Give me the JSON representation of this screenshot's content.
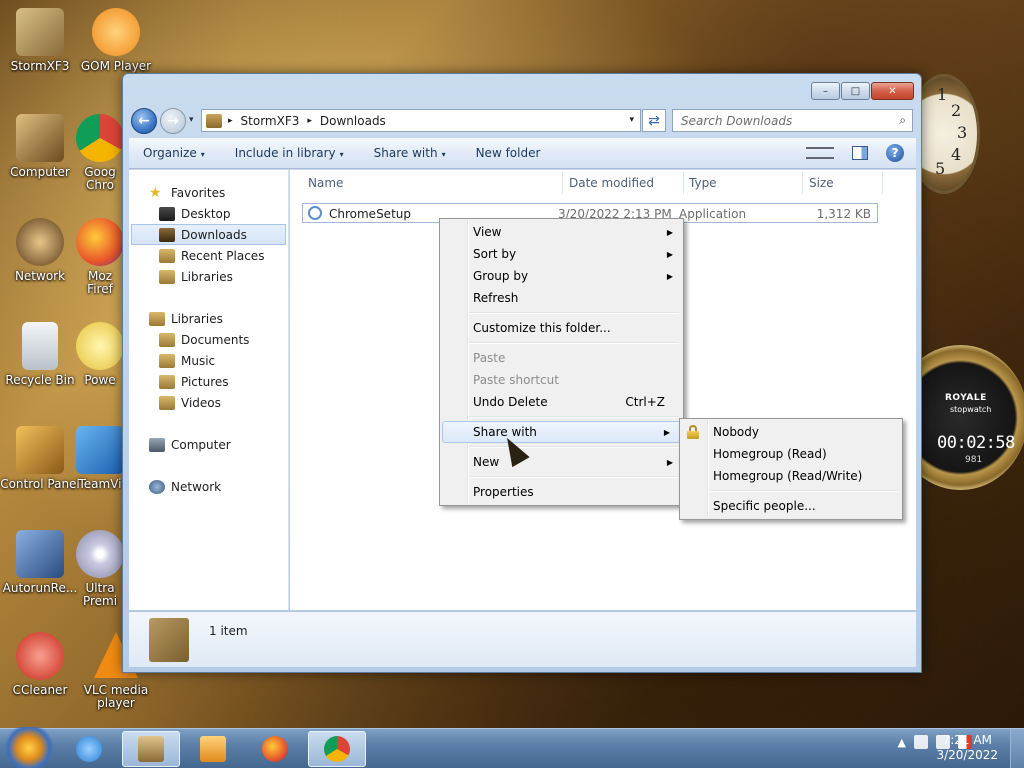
{
  "desktop": {
    "icons": [
      {
        "label": "StormXF3",
        "color": "#a88a52"
      },
      {
        "label": "GOM Player",
        "color": "#f39a1c"
      },
      {
        "label": "Computer",
        "color": "#c9a060"
      },
      {
        "label": "Goog Chro",
        "color": "#3d9b4a"
      },
      {
        "label": "Network",
        "color": "#c39a5a"
      },
      {
        "label": "Moz Firef",
        "color": "#e8752a"
      },
      {
        "label": "Recycle Bin",
        "color": "#d8dde2"
      },
      {
        "label": "Powe",
        "color": "#e6c23a"
      },
      {
        "label": "Control Panel",
        "color": "#c98a2e"
      },
      {
        "label": "TeamVi",
        "color": "#2c7fd1"
      },
      {
        "label": "AutorunRe...",
        "color": "#3a6ab8"
      },
      {
        "label": "Ultra Premi",
        "color": "#b0b0c0"
      },
      {
        "label": "CCleaner",
        "color": "#d33a2a"
      },
      {
        "label": "VLC media player",
        "color": "#f08a12"
      }
    ],
    "clock_numbers": [
      "1",
      "2",
      "3",
      "4",
      "5"
    ],
    "stopwatch": {
      "brand": "ROYALE",
      "sub": "stopwatch",
      "time": "00:02:58",
      "small": "981"
    }
  },
  "window": {
    "controls": {
      "minimize": "–",
      "maximize": "□",
      "close": "✕"
    },
    "nav": {
      "back": "←",
      "forward": "→",
      "history": "▾"
    },
    "address": {
      "crumbs": [
        "StormXF3",
        "Downloads"
      ],
      "sep": "▸",
      "drop": "▾"
    },
    "refresh": "⇄",
    "search": {
      "placeholder": "Search Downloads",
      "icon": "⌕"
    },
    "toolbar": {
      "organize": "Organize",
      "include": "Include in library",
      "share": "Share with",
      "new_folder": "New folder",
      "caret": "▾",
      "help": "?"
    },
    "nav_pane": {
      "favorites": "Favorites",
      "desktop": "Desktop",
      "downloads": "Downloads",
      "recent": "Recent Places",
      "libraries_fav": "Libraries",
      "libraries": "Libraries",
      "documents": "Documents",
      "music": "Music",
      "pictures": "Pictures",
      "videos": "Videos",
      "computer": "Computer",
      "network": "Network",
      "star": "★"
    },
    "columns": {
      "name": "Name",
      "date": "Date modified",
      "type": "Type",
      "size": "Size"
    },
    "file": {
      "name": "ChromeSetup",
      "date": "3/20/2022 2:13 PM",
      "type": "Application",
      "size": "1,312 KB"
    },
    "details": {
      "count": "1 item"
    }
  },
  "context_menu": {
    "view": "View",
    "sort_by": "Sort by",
    "group_by": "Group by",
    "refresh": "Refresh",
    "customize": "Customize this folder...",
    "paste": "Paste",
    "paste_shortcut": "Paste shortcut",
    "undo_delete": "Undo Delete",
    "undo_shortcut": "Ctrl+Z",
    "share_with": "Share with",
    "new": "New",
    "properties": "Properties",
    "arrow": "▶"
  },
  "share_submenu": {
    "nobody": "Nobody",
    "hg_read": "Homegroup (Read)",
    "hg_readwrite": "Homegroup (Read/Write)",
    "specific": "Specific people..."
  },
  "taskbar": {
    "time": "7:21 AM",
    "date": "3/20/2022",
    "tray_arrow": "▲",
    "buttons": [
      {
        "name": "ie-taskbar-button",
        "color": "#2a7fd6"
      },
      {
        "name": "explorer-taskbar-button",
        "color": "#b89a62"
      },
      {
        "name": "media-taskbar-button",
        "color": "#f0a030"
      },
      {
        "name": "firefox-taskbar-button",
        "color": "#e8752a"
      },
      {
        "name": "chrome-taskbar-button",
        "color": "#3d9b4a"
      }
    ]
  }
}
